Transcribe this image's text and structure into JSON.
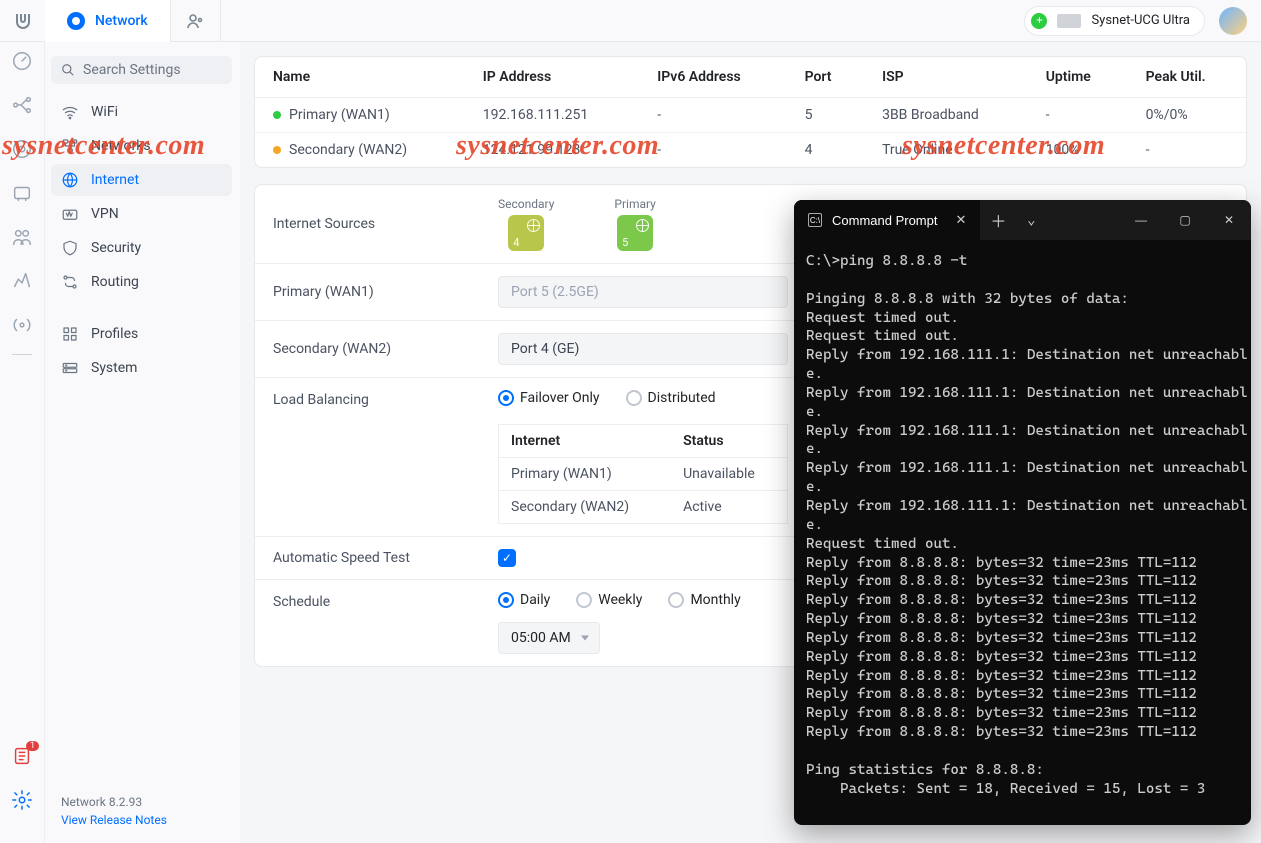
{
  "topbar": {
    "app_name": "Network",
    "device_name": "Sysnet-UCG Ultra"
  },
  "sidebar": {
    "search_placeholder": "Search Settings",
    "items": [
      {
        "label": "WiFi"
      },
      {
        "label": "Networks"
      },
      {
        "label": "Internet"
      },
      {
        "label": "VPN"
      },
      {
        "label": "Security"
      },
      {
        "label": "Routing"
      },
      {
        "label": "Profiles"
      },
      {
        "label": "System"
      }
    ],
    "footer_version": "Network 8.2.93",
    "footer_link": "View Release Notes"
  },
  "wan_table": {
    "headers": [
      "Name",
      "IP Address",
      "IPv6 Address",
      "Port",
      "ISP",
      "Uptime",
      "Peak Util."
    ],
    "rows": [
      {
        "status": "g",
        "name": "Primary (WAN1)",
        "ip": "192.168.111.251",
        "ipv6": "-",
        "port": "5",
        "isp": "3BB Broadband",
        "uptime": "-",
        "peak": "0%/0%"
      },
      {
        "status": "o",
        "name": "Secondary (WAN2)",
        "ip": "124.121.99.123",
        "ipv6": "-",
        "port": "4",
        "isp": "True Online",
        "uptime": "100%",
        "peak": "-"
      }
    ]
  },
  "form": {
    "sources_label": "Internet Sources",
    "tiles": [
      {
        "label": "Secondary",
        "num": "4",
        "cls": "yellow"
      },
      {
        "label": "Primary",
        "num": "5",
        "cls": "green"
      }
    ],
    "primary_label": "Primary (WAN1)",
    "primary_value": "Port 5 (2.5GE)",
    "secondary_label": "Secondary (WAN2)",
    "secondary_value": "Port 4 (GE)",
    "lb_label": "Load Balancing",
    "lb_options": [
      "Failover Only",
      "Distributed"
    ],
    "lb_selected": "Failover Only",
    "lb_table_headers": [
      "Internet",
      "Status"
    ],
    "lb_table_rows": [
      {
        "name": "Primary (WAN1)",
        "status": "Unavailable"
      },
      {
        "name": "Secondary (WAN2)",
        "status": "Active"
      }
    ],
    "ast_label": "Automatic Speed Test",
    "ast_checked": true,
    "sched_label": "Schedule",
    "sched_options": [
      "Daily",
      "Weekly",
      "Monthly"
    ],
    "sched_selected": "Daily",
    "sched_time": "05:00 AM"
  },
  "watermark": "sysnetcenter.com",
  "terminal": {
    "title": "Command Prompt",
    "lines": [
      "C:\\>ping 8.8.8.8 -t",
      "",
      "Pinging 8.8.8.8 with 32 bytes of data:",
      "Request timed out.",
      "Request timed out.",
      "Reply from 192.168.111.1: Destination net unreachable.",
      "Reply from 192.168.111.1: Destination net unreachable.",
      "Reply from 192.168.111.1: Destination net unreachable.",
      "Reply from 192.168.111.1: Destination net unreachable.",
      "Reply from 192.168.111.1: Destination net unreachable.",
      "Request timed out.",
      "Reply from 8.8.8.8: bytes=32 time=23ms TTL=112",
      "Reply from 8.8.8.8: bytes=32 time=23ms TTL=112",
      "Reply from 8.8.8.8: bytes=32 time=23ms TTL=112",
      "Reply from 8.8.8.8: bytes=32 time=23ms TTL=112",
      "Reply from 8.8.8.8: bytes=32 time=23ms TTL=112",
      "Reply from 8.8.8.8: bytes=32 time=23ms TTL=112",
      "Reply from 8.8.8.8: bytes=32 time=23ms TTL=112",
      "Reply from 8.8.8.8: bytes=32 time=23ms TTL=112",
      "Reply from 8.8.8.8: bytes=32 time=23ms TTL=112",
      "Reply from 8.8.8.8: bytes=32 time=23ms TTL=112",
      "",
      "Ping statistics for 8.8.8.8:",
      "    Packets: Sent = 18, Received = 15, Lost = 3"
    ]
  }
}
